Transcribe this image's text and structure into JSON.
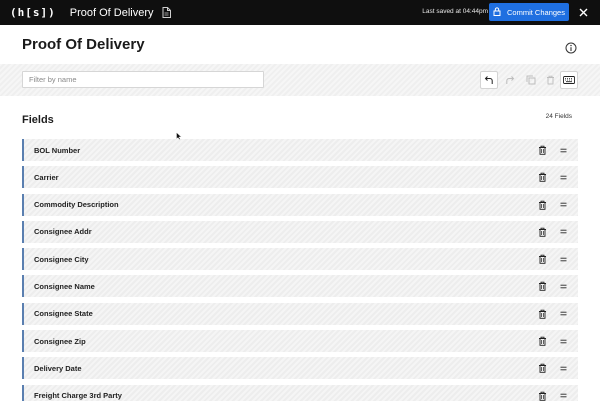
{
  "topbar": {
    "logo": "(h[s])",
    "doc_title": "Proof Of Delivery",
    "saved_text": "Last saved at 04:44pm",
    "commit_label": "Commit Changes",
    "icons": [
      "document-icon",
      "lock-icon",
      "close-icon"
    ]
  },
  "header": {
    "title": "Proof Of Delivery",
    "info_icon": "info-icon"
  },
  "toolbar": {
    "filter_placeholder": "Filter by name",
    "filter_value": "",
    "tools": [
      "undo-icon",
      "redo-icon",
      "copy-icon",
      "delete-icon",
      "keyboard-icon"
    ]
  },
  "fields": {
    "title": "Fields",
    "count_label": "24 Fields",
    "items": [
      {
        "label": "BOL Number"
      },
      {
        "label": "Carrier"
      },
      {
        "label": "Commodity Description"
      },
      {
        "label": "Consignee Addr"
      },
      {
        "label": "Consignee City"
      },
      {
        "label": "Consignee Name"
      },
      {
        "label": "Consignee State"
      },
      {
        "label": "Consignee Zip"
      },
      {
        "label": "Delivery Date"
      },
      {
        "label": "Freight Charge 3rd Party"
      }
    ]
  },
  "colors": {
    "topbar": "#0f0f0f",
    "accent": "#1f6fe0",
    "row_marker": "#5a7fb0"
  }
}
